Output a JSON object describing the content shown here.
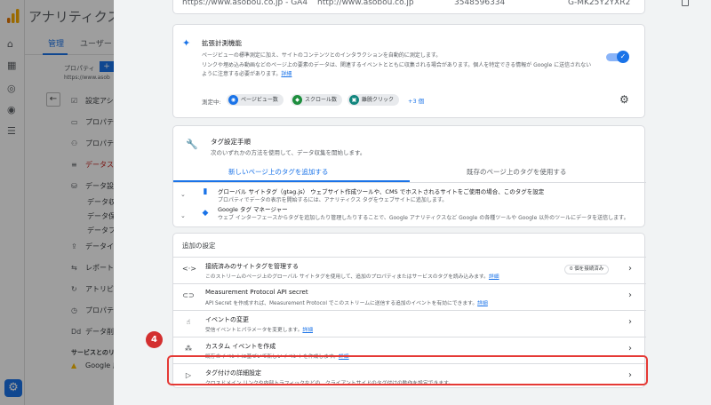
{
  "app": {
    "title": "アナリティクス"
  },
  "admin": {
    "tabs": [
      {
        "label": "管理"
      },
      {
        "label": "ユーザー"
      }
    ],
    "property_label": "プロパティ",
    "plus_label": "+",
    "property_url": "https://www.asob",
    "nav": [
      {
        "label": "設定アシス"
      },
      {
        "label": "プロパティ"
      },
      {
        "label": "プロパティ"
      },
      {
        "label": "データス"
      },
      {
        "label": "データ設定"
      },
      {
        "label": "データ収"
      },
      {
        "label": "データ保"
      },
      {
        "label": "データフ"
      },
      {
        "label": "データイ"
      },
      {
        "label": "レポート用"
      },
      {
        "label": "アトリビュ"
      },
      {
        "label": "プロパティ"
      },
      {
        "label": "データ削"
      }
    ],
    "section_label": "サービスとのリンク",
    "google_label": "Google 広"
  },
  "stream_top": {
    "url1": "https://www.asobou.co.jp - GA4",
    "url2": "http://www.asobou.co.jp",
    "stream_id": "3548596334",
    "measurement_id": "G-MK25Y2YXR2"
  },
  "enhanced": {
    "title": "拡張計測機能",
    "desc_line1": "ページビューの標準測定に加え、サイトのコンテンツとのインタラクションを自動的に測定します。",
    "desc_line2": "リンクや埋め込み動画などのページ上の要素のデータは、関連するイベントとともに収集される場合があります。個人を特定できる情報が Google に送信されない",
    "desc_line3": "ように注意する必要があります。",
    "learn_more": "詳細",
    "measuring_label": "測定中:",
    "chips": [
      {
        "label": "ページビュー数",
        "color": "#1a73e8",
        "icon": "eye-icon"
      },
      {
        "label": "スクロール数",
        "color": "#1e8e3e",
        "icon": "scroll-icon"
      },
      {
        "label": "離脱クリック",
        "color": "#12867e",
        "icon": "cursor-icon"
      }
    ],
    "more_count": "+3 個"
  },
  "tag_setup": {
    "title": "タグ設定手順",
    "subtitle": "次のいずれかの方法を使用して、データ収集を開始します。",
    "tab_new": "新しいページ上のタグを追加する",
    "tab_existing": "既存のページ上のタグを使用する",
    "options": [
      {
        "title": "グローバル サイトタグ（gtag.js） ウェブサイト作成ツールや、CMS でホストされるサイトをご使用の場合、このタグを設定",
        "desc": "プロパティでデータの表示を開始するには、アナリティクス タグをウェブサイトに追加します。"
      },
      {
        "title": "Google タグ マネージャー",
        "desc": "ウェブ インターフェースからタグを追加したり管理したりすることで、Google アナリティクスなど Google の各種ツールや Google 以外のツールにデータを送信します。"
      }
    ]
  },
  "additional": {
    "title": "追加の設定",
    "rows": [
      {
        "title": "接続済みのサイトタグを管理する",
        "desc": "このストリームのページ上のグローバル サイトタグを使用して、追加のプロパティまたはサービスのタグを読み込みます。",
        "link": "詳細",
        "badge": "0 個を接続済み"
      },
      {
        "title": "Measurement Protocol API secret",
        "desc": "API Secret を作成すれば、Measurement Protocol でこのストリームに送信する追加のイベントを有効にできます。",
        "link": "詳細"
      },
      {
        "title": "イベントの変更",
        "desc": "受信イベントとパラメータを変更します。",
        "link": "詳細"
      },
      {
        "title": "カスタム イベントを作成",
        "desc": "既存のイベントに基づいて新しいイベントを作成します。",
        "link": "詳細"
      },
      {
        "title": "タグ付けの詳細設定",
        "desc": "クロスドメイン リンクや内部トラフィックなどの、クライアントサイドのタグ付けの動作を設定できます。"
      }
    ]
  },
  "callout": {
    "number": "4",
    "color": "#e53935"
  }
}
